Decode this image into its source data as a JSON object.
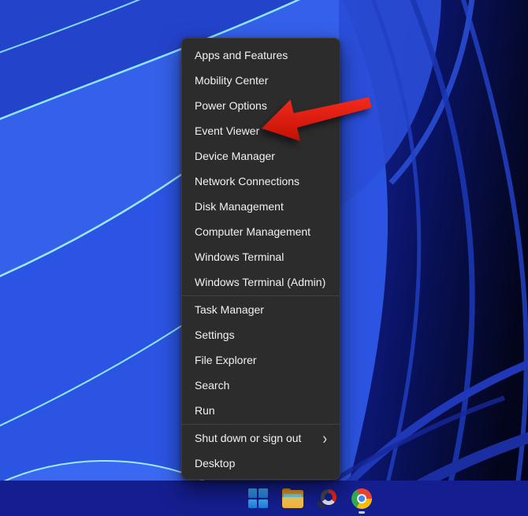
{
  "menu": {
    "background": "#2c2c2c",
    "text_color": "#f1f1f1",
    "groups": [
      {
        "items": [
          {
            "label": "Apps and Features"
          },
          {
            "label": "Mobility Center"
          },
          {
            "label": "Power Options"
          },
          {
            "label": "Event Viewer"
          },
          {
            "label": "Device Manager"
          },
          {
            "label": "Network Connections"
          },
          {
            "label": "Disk Management"
          },
          {
            "label": "Computer Management"
          },
          {
            "label": "Windows Terminal"
          },
          {
            "label": "Windows Terminal (Admin)"
          }
        ]
      },
      {
        "items": [
          {
            "label": "Task Manager"
          },
          {
            "label": "Settings"
          },
          {
            "label": "File Explorer"
          },
          {
            "label": "Search"
          },
          {
            "label": "Run"
          }
        ]
      },
      {
        "items": [
          {
            "label": "Shut down or sign out",
            "submenu_glyph": "›"
          },
          {
            "label": "Desktop"
          }
        ]
      }
    ]
  },
  "annotation": {
    "type": "arrow",
    "points_at": "Event Viewer",
    "color": "#e2190e"
  },
  "taskbar": {
    "background": "#141e8f",
    "icons": [
      {
        "name": "windows-start-icon"
      },
      {
        "name": "file-explorer-icon"
      },
      {
        "name": "magnifier-app-icon"
      },
      {
        "name": "chrome-icon",
        "running": true
      }
    ]
  },
  "wallpaper": {
    "style": "windows-11-bloom",
    "bright_blue": "#2e58e8",
    "deep_navy": "#04071f",
    "ribbon_highlight": "#8ee7fb"
  }
}
